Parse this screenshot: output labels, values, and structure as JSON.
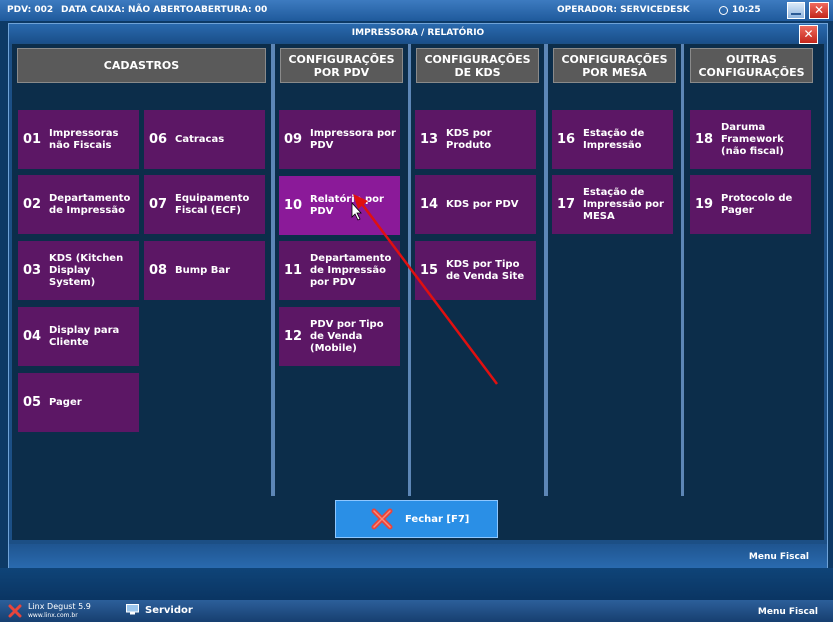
{
  "topbar": {
    "pdv": "PDV: 002",
    "data_caixa": "DATA CAIXA: NÃO ABERTO",
    "abertura": "ABERTURA: 00",
    "operador": "OPERADOR: SERVICEDESK",
    "time": "10:25"
  },
  "dialog": {
    "title": "IMPRESSORA / RELATÓRIO",
    "close_glyph": "✕"
  },
  "columns": [
    {
      "header": "CADASTROS"
    },
    {
      "header": "CONFIGURAÇÕES POR PDV"
    },
    {
      "header": "CONFIGURAÇÕES DE KDS"
    },
    {
      "header": "CONFIGURAÇÕES POR MESA"
    },
    {
      "header": "OUTRAS CONFIGURAÇÕES"
    }
  ],
  "tiles": [
    {
      "num": "01",
      "label": "Impressoras não Fiscais"
    },
    {
      "num": "02",
      "label": "Departamento de Impressão"
    },
    {
      "num": "03",
      "label": "KDS (Kitchen Display System)"
    },
    {
      "num": "04",
      "label": "Display para Cliente"
    },
    {
      "num": "05",
      "label": "Pager"
    },
    {
      "num": "06",
      "label": "Catracas"
    },
    {
      "num": "07",
      "label": "Equipamento Fiscal (ECF)"
    },
    {
      "num": "08",
      "label": "Bump Bar"
    },
    {
      "num": "09",
      "label": "Impressora por PDV"
    },
    {
      "num": "10",
      "label": "Relatório por PDV"
    },
    {
      "num": "11",
      "label": "Departamento de Impressão por PDV"
    },
    {
      "num": "12",
      "label": "PDV por Tipo de Venda (Mobile)"
    },
    {
      "num": "13",
      "label": "KDS por Produto"
    },
    {
      "num": "14",
      "label": "KDS por PDV"
    },
    {
      "num": "15",
      "label": "KDS por Tipo de Venda Site"
    },
    {
      "num": "16",
      "label": "Estação de Impressão"
    },
    {
      "num": "17",
      "label": "Estação de Impressão por MESA"
    },
    {
      "num": "18",
      "label": "Daruma Framework (não fiscal)"
    },
    {
      "num": "19",
      "label": "Protocolo de Pager"
    }
  ],
  "fechar_label": "Fechar [F7]",
  "footer": {
    "menu_fiscal": "Menu Fiscal"
  },
  "taskbar": {
    "app_name": "Linx Degust 5.9",
    "app_url": "www.linx.com.br",
    "servidor": "Servidor",
    "menu_fiscal": "Menu Fiscal"
  },
  "colors": {
    "tile": "#5c1765",
    "tile_active": "#8b1a99",
    "header": "#5a5a5a",
    "button": "#2a8fe6",
    "annotation_arrow": "#e01010"
  },
  "icons": [
    "clock-icon",
    "minimize-icon",
    "close-icon",
    "fechar-x-icon",
    "linx-logo-icon",
    "monitor-icon",
    "mouse-cursor-icon"
  ]
}
